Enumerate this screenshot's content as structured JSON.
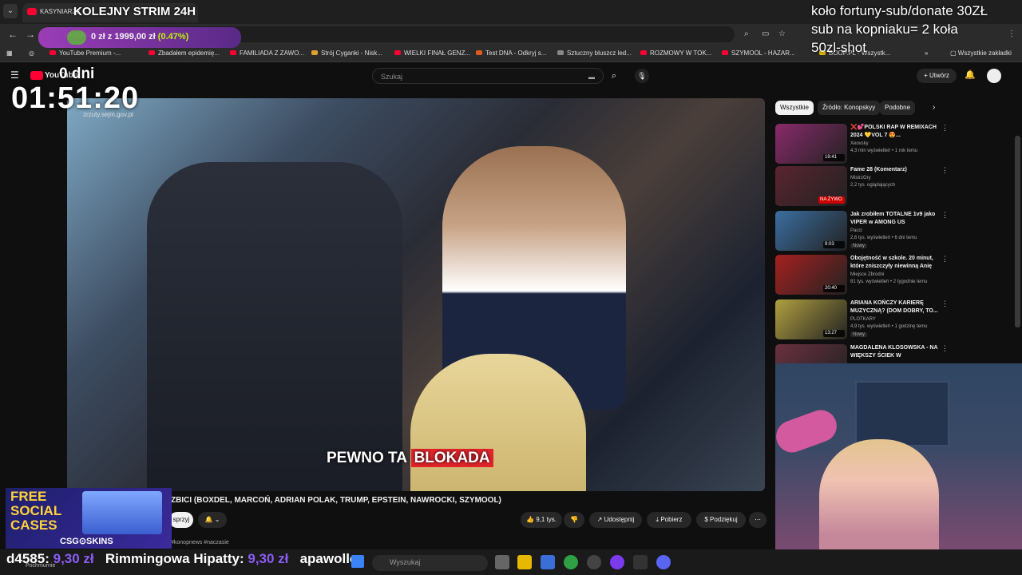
{
  "browser": {
    "tab_title": "KASYNIARZE",
    "url": "youtube.com/watch?v=YSW_dmO",
    "bookmarks": [
      "YouTube Premium -...",
      "Zbadałem epidemię...",
      "FAMILIADA Z ZAWO...",
      "Strój Cyganki - Nisk...",
      "WIELKI FINAŁ GENZ...",
      "Test DNA - Odkryj s...",
      "Sztuczny bluszcz led...",
      "ROZMOWY W TOK...",
      "SZYMOOL - HAZAR...",
      "BOOP.PL - Wszystk..."
    ],
    "all_bookmarks": "Wszystkie zakładki"
  },
  "youtube": {
    "logo": "YouTube",
    "search_placeholder": "Szukaj",
    "create_label": "Utwórz",
    "caption_plain": "PEWNO TA",
    "caption_highlight": "BLOKADA",
    "watermark": "zrzuty.sejm.gov.pl",
    "video_title": "ZBICI (BOXDEL, MARCOŃ, ADRIAN POLAK, TRUMP, EPSTEIN, NAWROCKI, SZYMOOL)",
    "support_label": "sprzyj",
    "likes": "9,1 tys.",
    "share_label": "Udostępnij",
    "download_label": "Pobierz",
    "thanks_label": "Podziękuj",
    "tags": "#konopnews #naczasie",
    "chips": [
      "Wszystkie",
      "Źródło: Konopskyy",
      "Podobne"
    ],
    "recommendations": [
      {
        "title": "❌💕POLSKI RAP W REMIXACH 2024 💛VOL 7 😍...",
        "channel": "Xeovsky",
        "meta": "4,3 mln wyświetleń • 1 rok temu",
        "duration": "19:41",
        "color": "#8a2a6a"
      },
      {
        "title": "Fame 28 (Komentarz)",
        "channel": "MistrzGry",
        "meta": "2,2 tys. oglądających",
        "duration": "NA ŻYWO",
        "color": "#5a2430"
      },
      {
        "title": "Jak zrobiłem TOTALNE 1v9 jako VIPER w AMONG US",
        "channel": "Pacci",
        "meta": "2,6 tys. wyświetleń • 6 dni temu",
        "duration": "9:03",
        "color": "#3b6ea0",
        "badge": "Nowy"
      },
      {
        "title": "Obojętność w szkole. 20 minut, które zniszczyły niewinną Anię",
        "channel": "Miejsce Zbrodni",
        "meta": "81 tys. wyświetleń • 2 tygodnie temu",
        "duration": "20:40",
        "color": "#a62020"
      },
      {
        "title": "ARIANA KOŃCZY KARIERĘ MUZYCZNĄ? (DOM DOBRY, TO...",
        "channel": "PLOTKARY",
        "meta": "4,9 tys. wyświetleń • 1 godzinę temu",
        "duration": "13:27",
        "color": "#b0a040",
        "badge": "Nowy"
      },
      {
        "title": "MAGDALENA KLOSOWSKA - NA WIĘKSZY ŚCIEK W",
        "channel": "",
        "meta": "",
        "duration": "",
        "color": "#6a3040"
      }
    ]
  },
  "overlay": {
    "stream_title": "KOLEJNY STRIM 24H",
    "donate_current": "0 zł",
    "donate_sep": "z",
    "donate_goal": "1999,00 zł",
    "donate_pct": "(0.47%)",
    "right_text_1": "koło fortuny-sub/donate 30ZŁ",
    "right_text_2": "sub na kopniaku= 2 koła",
    "right_text_3": "50zl-shot",
    "timer_days": "0 dni",
    "timer": "01:51:20",
    "promo_line1": "FREE",
    "promo_line2": "SOCIAL",
    "promo_line3": "CASES",
    "promo_brand": "CSG⊙SKINS",
    "ticker_a": "d4585:",
    "ticker_a_amt": "9,30 zł",
    "ticker_b": "Rimmingowa Hipatty:",
    "ticker_b_amt": "9,30 zł",
    "ticker_c": "apawollo",
    "weather": "Pochmurnie"
  },
  "taskbar": {
    "search": "Wyszukaj"
  }
}
